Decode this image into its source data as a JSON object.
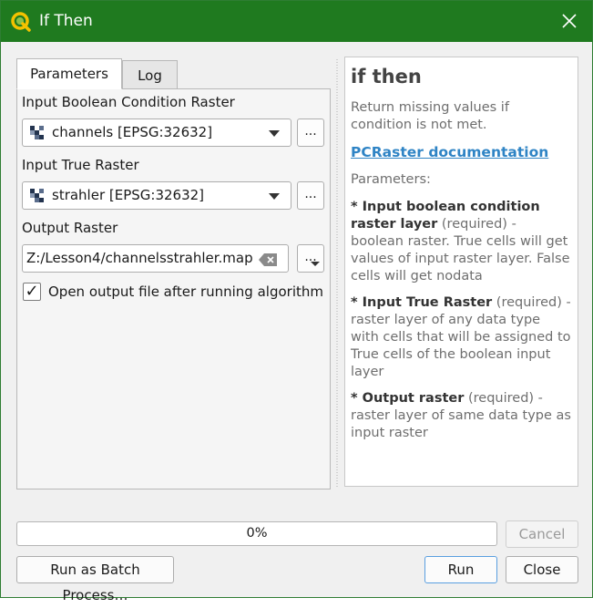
{
  "window": {
    "title": "If Then",
    "app_icon": "qgis-logo-icon",
    "close_icon": "close-icon"
  },
  "tabs": [
    {
      "label": "Parameters",
      "active": true
    },
    {
      "label": "Log",
      "active": false
    }
  ],
  "params": {
    "condition_label": "Input Boolean Condition Raster",
    "condition_value": "channels [EPSG:32632]",
    "true_label": "Input True Raster",
    "true_value": "strahler [EPSG:32632]",
    "output_label": "Output Raster",
    "output_value": "Z:/Lesson4/channelsstrahler.map",
    "browse_label": "...",
    "open_output_checked": true,
    "open_output_label": "Open output file after running algorithm"
  },
  "help": {
    "title": "if then",
    "description": "Return missing values if condition is not met.",
    "link_text": "PCRaster documentation",
    "params_heading": "Parameters:",
    "items": [
      {
        "star": "* ",
        "name": "Input boolean condition raster layer",
        "req": " (required)",
        "desc": " - boolean raster. True cells will get values of input raster layer. False cells will get nodata"
      },
      {
        "star": "* ",
        "name": "Input True Raster",
        "req": " (required)",
        "desc": " - raster layer of any data type with cells that will be assigned to True cells of the boolean input layer"
      },
      {
        "star": "* ",
        "name": "Output raster",
        "req": " (required)",
        "desc": " - raster layer of same data type as input raster"
      }
    ]
  },
  "progress": {
    "text": "0%",
    "value": 0
  },
  "buttons": {
    "cancel": "Cancel",
    "batch": "Run as Batch Process…",
    "run": "Run",
    "close": "Close"
  },
  "colors": {
    "titlebar": "#1f7a1f",
    "link": "#2f84c5",
    "run_border": "#5a9fe0"
  }
}
